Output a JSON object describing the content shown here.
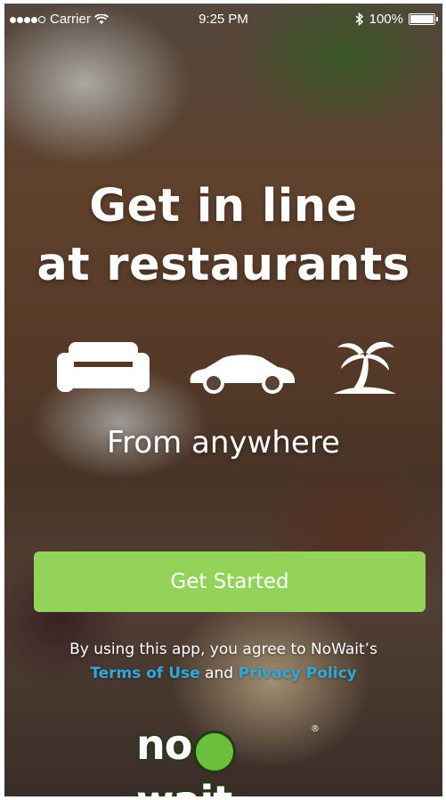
{
  "status_bar": {
    "carrier": "Carrier",
    "time": "9:25 PM",
    "battery": "100%"
  },
  "headline": {
    "line1": "Get in line",
    "line2": "at restaurants"
  },
  "icons": [
    "couch-icon",
    "car-icon",
    "palm-tree-icon"
  ],
  "subheadline": "From anywhere",
  "cta_label": "Get Started",
  "legal": {
    "prefix": "By using this app, you agree to NoWait’s",
    "terms": "Terms of Use",
    "and": "and",
    "privacy": "Privacy Policy"
  },
  "logo": {
    "part1": "no",
    "part2": "wait",
    "reg": "®"
  },
  "colors": {
    "cta": "#94d35a",
    "link": "#2fa9dc",
    "logo_mark": "#6bbf3b"
  }
}
